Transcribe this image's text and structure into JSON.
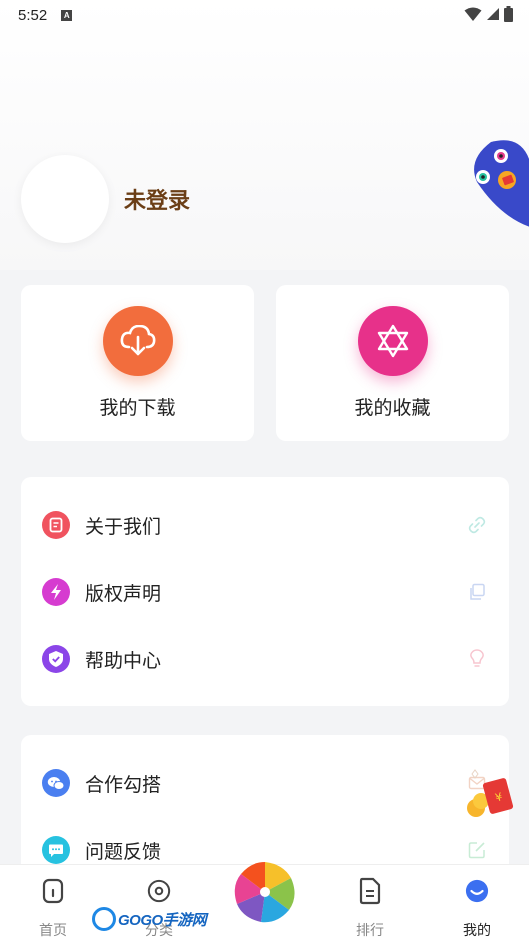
{
  "status_bar": {
    "time": "5:52",
    "indicator": "A"
  },
  "profile": {
    "login_text": "未登录"
  },
  "quick_actions": [
    {
      "label": "我的下载",
      "icon": "cloud-download-icon",
      "color": "#f26d3d"
    },
    {
      "label": "我的收藏",
      "icon": "star-of-david-icon",
      "color": "#e7318a"
    }
  ],
  "menu_group_1": [
    {
      "label": "关于我们",
      "icon": "document-icon",
      "color": "#f0535f",
      "trail_icon": "link-icon"
    },
    {
      "label": "版权声明",
      "icon": "lightning-icon",
      "color": "#d63cd0",
      "trail_icon": "copy-icon"
    },
    {
      "label": "帮助中心",
      "icon": "shield-icon",
      "color": "#8b45e8",
      "trail_icon": "bulb-icon"
    }
  ],
  "menu_group_2": [
    {
      "label": "合作勾搭",
      "icon": "wechat-icon",
      "color": "#4a7ff0",
      "trail_icon": "mail-icon"
    },
    {
      "label": "问题反馈",
      "icon": "chat-icon",
      "color": "#27c2e0",
      "trail_icon": "edit-icon"
    }
  ],
  "bottom_nav": [
    {
      "label": "首页",
      "icon": "home-icon"
    },
    {
      "label": "分类",
      "icon": "category-icon"
    },
    {
      "label": "排行",
      "icon": "rank-icon"
    },
    {
      "label": "我的",
      "icon": "profile-icon",
      "active": true
    }
  ],
  "watermark": {
    "text": "GOGO手游网"
  },
  "colors": {
    "accent": "#3b6ff0",
    "login_text": "#6b3e16"
  }
}
